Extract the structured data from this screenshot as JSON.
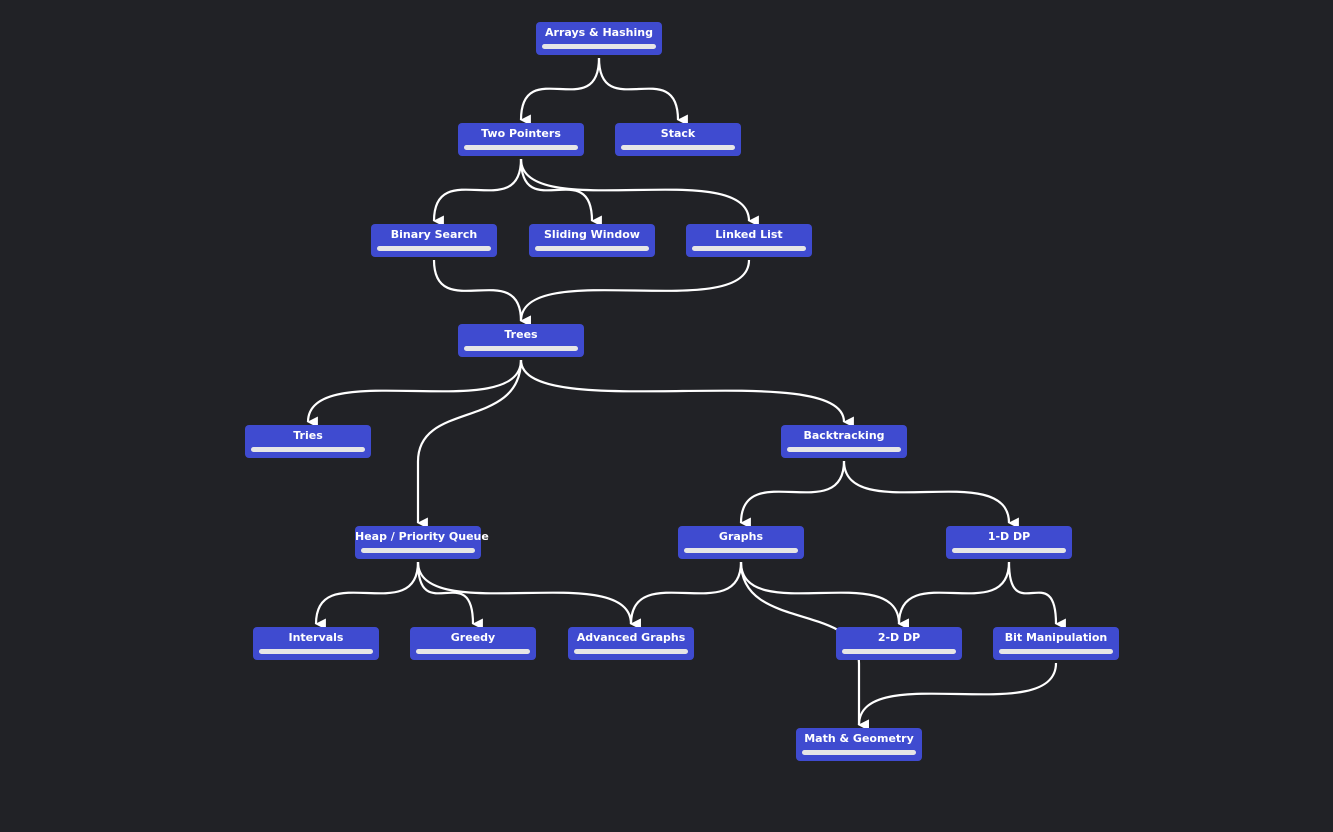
{
  "colors": {
    "background": "#212226",
    "node": "#3f4bd0",
    "edge": "#ffffff",
    "progress_track": "#e6e6e6",
    "progress_fill": "#2fbf5b"
  },
  "nodes": [
    {
      "id": "arrays",
      "label": "Arrays & Hashing",
      "progress": 0
    },
    {
      "id": "twoptr",
      "label": "Two Pointers",
      "progress": 0
    },
    {
      "id": "stack",
      "label": "Stack",
      "progress": 0
    },
    {
      "id": "binsearch",
      "label": "Binary Search",
      "progress": 0
    },
    {
      "id": "sliding",
      "label": "Sliding Window",
      "progress": 0
    },
    {
      "id": "linked",
      "label": "Linked List",
      "progress": 0
    },
    {
      "id": "trees",
      "label": "Trees",
      "progress": 0
    },
    {
      "id": "tries",
      "label": "Tries",
      "progress": 0
    },
    {
      "id": "backtracking",
      "label": "Backtracking",
      "progress": 0
    },
    {
      "id": "heap",
      "label": "Heap / Priority Queue",
      "progress": 0
    },
    {
      "id": "graphs",
      "label": "Graphs",
      "progress": 0
    },
    {
      "id": "dp1",
      "label": "1-D DP",
      "progress": 0
    },
    {
      "id": "intervals",
      "label": "Intervals",
      "progress": 0
    },
    {
      "id": "greedy",
      "label": "Greedy",
      "progress": 0
    },
    {
      "id": "advgraphs",
      "label": "Advanced Graphs",
      "progress": 0
    },
    {
      "id": "dp2",
      "label": "2-D DP",
      "progress": 0
    },
    {
      "id": "bit",
      "label": "Bit Manipulation",
      "progress": 0
    },
    {
      "id": "math",
      "label": "Math & Geometry",
      "progress": 0
    }
  ],
  "edges": [
    [
      "arrays",
      "twoptr"
    ],
    [
      "arrays",
      "stack"
    ],
    [
      "twoptr",
      "binsearch"
    ],
    [
      "twoptr",
      "sliding"
    ],
    [
      "twoptr",
      "linked"
    ],
    [
      "binsearch",
      "trees"
    ],
    [
      "linked",
      "trees"
    ],
    [
      "trees",
      "tries"
    ],
    [
      "trees",
      "heap"
    ],
    [
      "trees",
      "backtracking"
    ],
    [
      "backtracking",
      "graphs"
    ],
    [
      "backtracking",
      "dp1"
    ],
    [
      "heap",
      "intervals"
    ],
    [
      "heap",
      "greedy"
    ],
    [
      "heap",
      "advgraphs"
    ],
    [
      "graphs",
      "advgraphs"
    ],
    [
      "graphs",
      "dp2"
    ],
    [
      "graphs",
      "math"
    ],
    [
      "dp1",
      "dp2"
    ],
    [
      "dp1",
      "bit"
    ],
    [
      "bit",
      "math"
    ]
  ]
}
